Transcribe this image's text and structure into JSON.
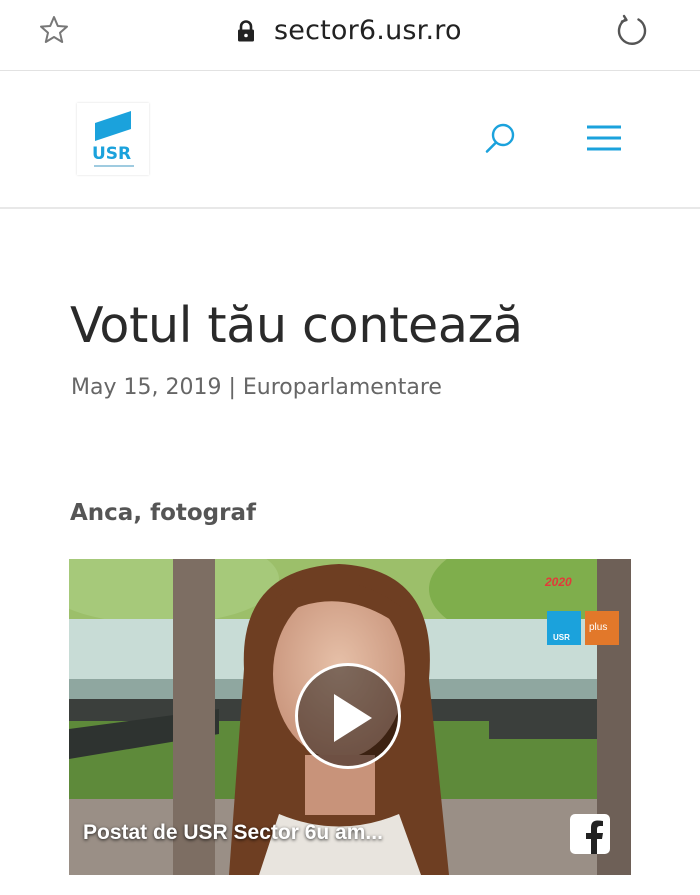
{
  "browser": {
    "url": "sector6.usr.ro"
  },
  "header": {
    "logo_text": "USR"
  },
  "post": {
    "title": "Votul tău contează",
    "date": "May 15, 2019",
    "separator": "|",
    "category": "Europarlamentare",
    "subheading": "Anca, fotograf"
  },
  "video": {
    "caption": "Postat de USR Sector 6u am...",
    "badge_year": "2020",
    "badge_usr": "USR",
    "badge_plus": "plus"
  },
  "colors": {
    "brand_blue": "#1ba2dc",
    "plus_orange": "#e2782a"
  }
}
